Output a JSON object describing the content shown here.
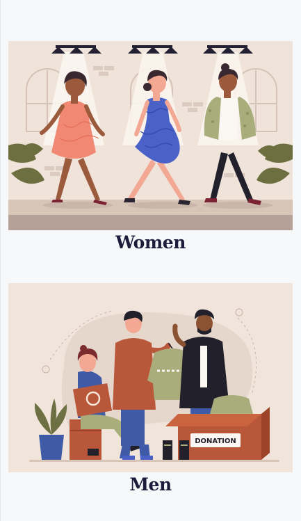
{
  "categories": [
    {
      "title": "Women"
    },
    {
      "title": "Men"
    },
    {
      "title": "DONATION"
    }
  ],
  "colors": {
    "page_bg": "#f6f8fa",
    "title_text": "#1e1c3a",
    "women_art_bg": "#efe3da",
    "men_art_bg": "#f0e4db"
  }
}
